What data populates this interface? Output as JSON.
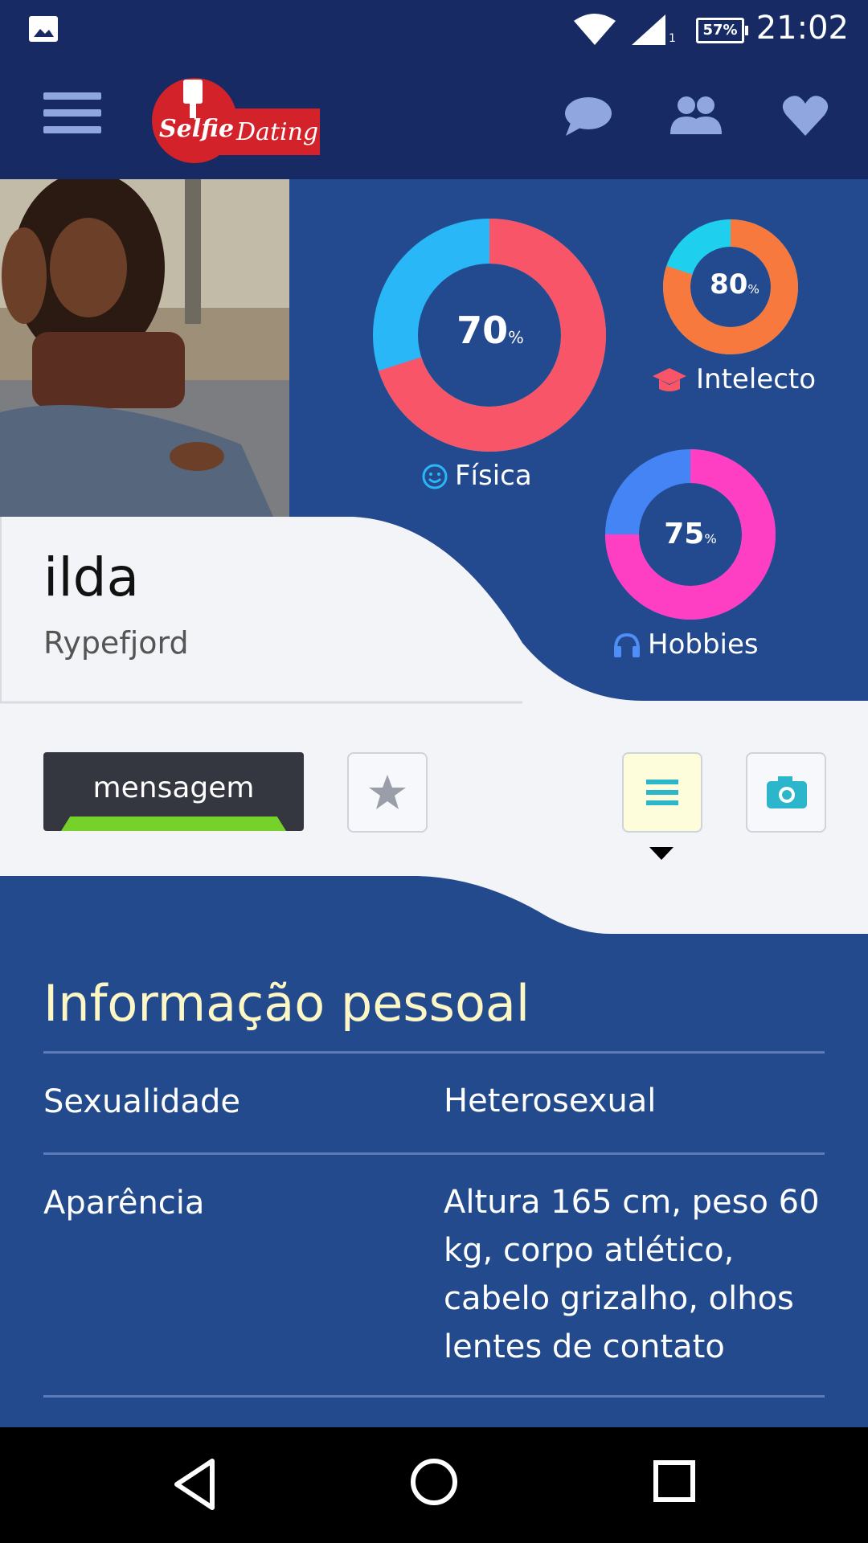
{
  "status": {
    "battery": "57%",
    "time": "21:02",
    "signal_sub": "1"
  },
  "appbar": {
    "logo_text_1": "Selfie",
    "logo_text_2": "Dating",
    "icons": [
      "menu-icon",
      "chat-icon",
      "group-icon",
      "heart-icon"
    ]
  },
  "profile": {
    "name": "ilda",
    "city": "Rypefjord"
  },
  "charts": [
    {
      "value": "70",
      "unit": "%",
      "label": "Física",
      "percent": 70,
      "color_main": "#f85568",
      "color_rest": "#29b7f7",
      "icon": "smile-icon"
    },
    {
      "value": "80",
      "unit": "%",
      "label": "Intelecto",
      "percent": 80,
      "color_main": "#f8793d",
      "color_rest": "#1fd0ee",
      "icon": "graduation-cap-icon"
    },
    {
      "value": "75",
      "unit": "%",
      "label": "Hobbies",
      "percent": 75,
      "color_main": "#ff3fc3",
      "color_rest": "#4484f4",
      "icon": "headphones-icon"
    }
  ],
  "actions": {
    "message_label": "mensagem"
  },
  "info": {
    "title": "Informação pessoal",
    "rows": [
      {
        "label": "Sexualidade",
        "value": "Heterosexual"
      },
      {
        "label": "Aparência",
        "value": "Altura 165 cm, peso 60 kg, corpo atlético, cabelo grizalho, olhos lentes de contato"
      }
    ]
  },
  "colors": {
    "bar": "#172a63",
    "panel": "#23498e",
    "title": "#fdf7c5",
    "green": "#76d22b"
  }
}
